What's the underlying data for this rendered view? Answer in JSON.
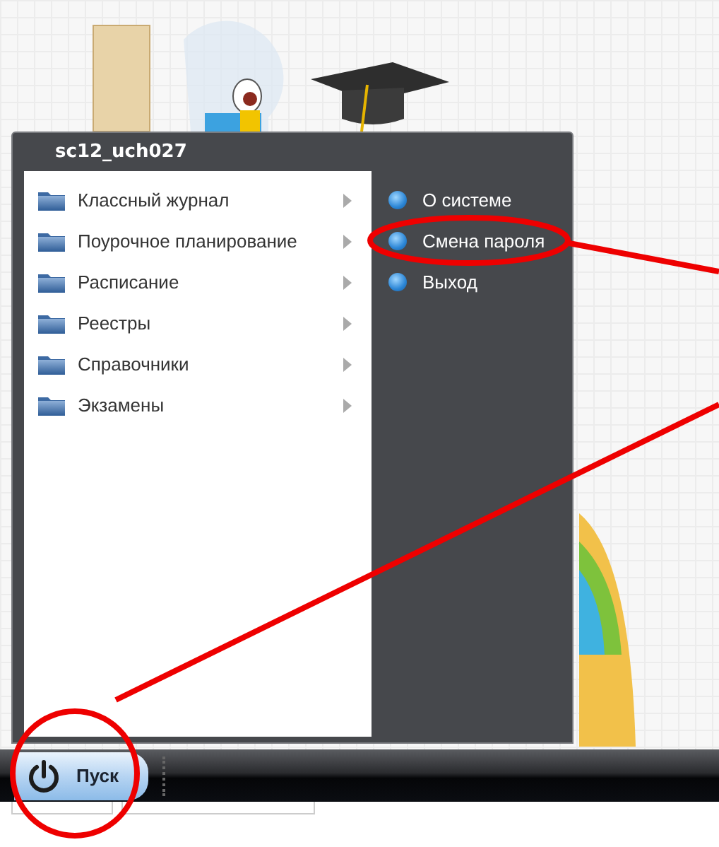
{
  "menu": {
    "user": "sc12_uch027",
    "programs": [
      {
        "label": "Классный журнал",
        "has_submenu": true
      },
      {
        "label": "Поурочное планирование",
        "has_submenu": true
      },
      {
        "label": "Расписание",
        "has_submenu": true
      },
      {
        "label": "Реестры",
        "has_submenu": true
      },
      {
        "label": "Справочники",
        "has_submenu": true
      },
      {
        "label": "Экзамены",
        "has_submenu": true
      }
    ],
    "system": [
      {
        "label": "О системе"
      },
      {
        "label": "Смена пароля"
      },
      {
        "label": "Выход"
      }
    ]
  },
  "taskbar": {
    "start_button": "Пуск"
  }
}
